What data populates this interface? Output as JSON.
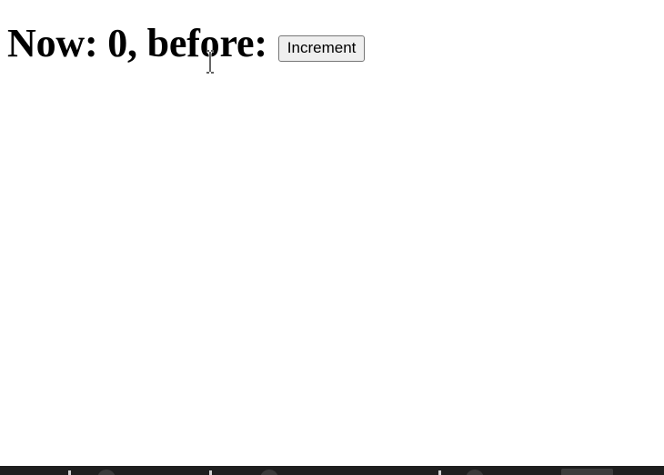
{
  "heading": {
    "text": "Now: 0, before:"
  },
  "button": {
    "label": "Increment"
  },
  "icons": {
    "cursor": "text-cursor-icon"
  },
  "colors": {
    "background": "#ffffff",
    "text": "#000000",
    "button_bg": "#efefef",
    "button_border": "#767676",
    "taskbar": "#1f1f1f"
  }
}
